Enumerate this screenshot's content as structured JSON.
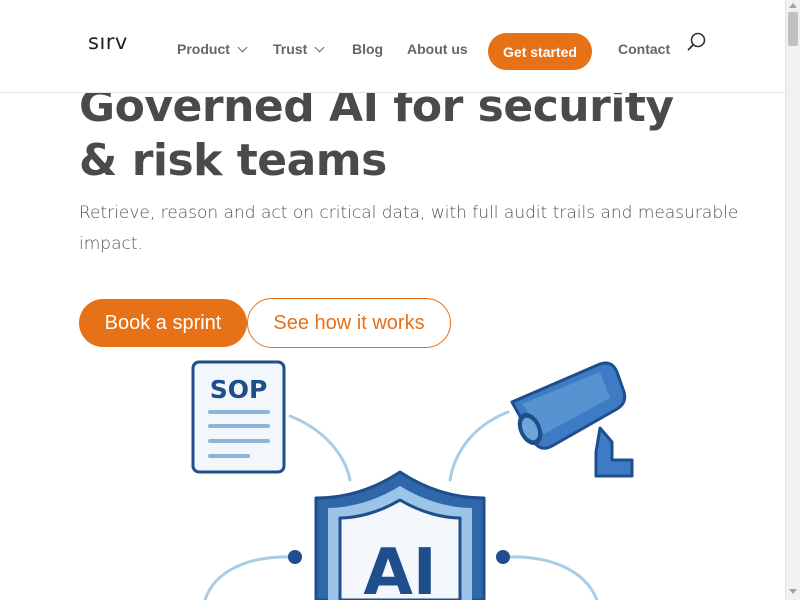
{
  "header": {
    "logo_text": "sırv",
    "nav": {
      "product": "Product",
      "trust": "Trust",
      "blog": "Blog",
      "about": "About us",
      "get_started": "Get started",
      "contact": "Contact"
    },
    "search_icon": "search-icon"
  },
  "hero": {
    "title": "Governed AI for security & risk teams",
    "subtitle": "Retrieve, reason and act on critical data, with full audit trails and measurable impact.",
    "primary_cta": "Book a sprint",
    "secondary_cta": "See how it works"
  },
  "illustration": {
    "document_label": "SOP",
    "shield_label": "AI",
    "icons": [
      "document-icon",
      "security-camera-icon",
      "shield-icon"
    ]
  },
  "colors": {
    "accent": "#e67117",
    "heading": "#4a4a4a",
    "illustration_blue": "#1f4e8c",
    "illustration_light": "#a9cde6"
  }
}
